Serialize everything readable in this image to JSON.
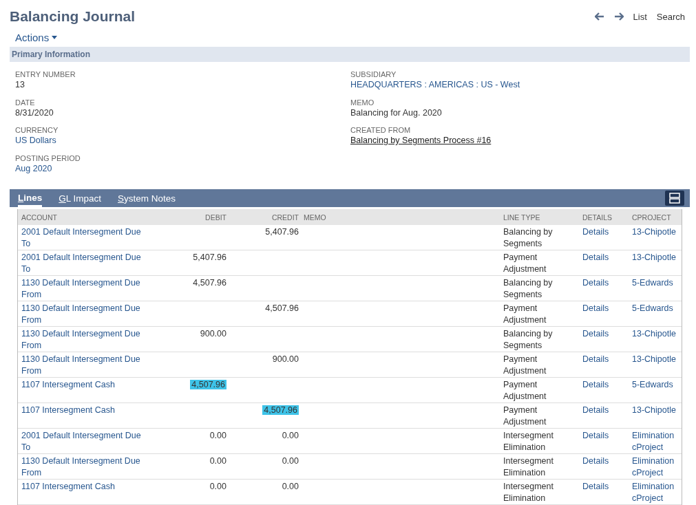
{
  "page": {
    "title": "Balancing Journal",
    "nav": [
      "List",
      "Search"
    ],
    "actions": "Actions"
  },
  "primary_information": {
    "heading": "Primary Information",
    "left": [
      {
        "label": "ENTRY NUMBER",
        "value": "13",
        "kind": "text"
      },
      {
        "label": "DATE",
        "value": "8/31/2020",
        "kind": "text"
      },
      {
        "label": "CURRENCY",
        "value": "US Dollars",
        "kind": "link"
      },
      {
        "label": "POSTING PERIOD",
        "value": "Aug 2020",
        "kind": "link"
      }
    ],
    "right": [
      {
        "label": "SUBSIDIARY",
        "value": "HEADQUARTERS : AMERICAS : US - West",
        "kind": "link"
      },
      {
        "label": "MEMO",
        "value": "Balancing for Aug. 2020",
        "kind": "text"
      },
      {
        "label": "CREATED FROM",
        "value": "Balancing by Segments Process #16",
        "kind": "record"
      }
    ]
  },
  "tabs": [
    {
      "label": "Lines",
      "selected": true
    },
    {
      "label": "GL Impact",
      "selected": false
    },
    {
      "label": "System Notes",
      "selected": false
    }
  ],
  "table": {
    "columns": [
      "ACCOUNT",
      "DEBIT",
      "CREDIT",
      "MEMO",
      "LINE TYPE",
      "DETAILS",
      "CPROJECT"
    ],
    "rows": [
      {
        "account": "2001 Default Intersegment Due To",
        "credit": {
          "text": "5,407.96",
          "highlighted": false
        },
        "line_type": "Balancing by Segments",
        "details": "Details",
        "cproject": "13-Chipotle"
      },
      {
        "account": "2001 Default Intersegment Due To",
        "debit": {
          "text": "5,407.96",
          "highlighted": false
        },
        "line_type": "Payment Adjustment",
        "details": "Details",
        "cproject": "13-Chipotle"
      },
      {
        "account": "1130 Default Intersegment Due From",
        "debit": {
          "text": "4,507.96",
          "highlighted": false
        },
        "line_type": "Balancing by Segments",
        "details": "Details",
        "cproject": "5-Edwards"
      },
      {
        "account": "1130 Default Intersegment Due From",
        "credit": {
          "text": "4,507.96",
          "highlighted": false
        },
        "line_type": "Payment Adjustment",
        "details": "Details",
        "cproject": "5-Edwards"
      },
      {
        "account": "1130 Default Intersegment Due From",
        "debit": {
          "text": "900.00",
          "highlighted": false
        },
        "line_type": "Balancing by Segments",
        "details": "Details",
        "cproject": "13-Chipotle"
      },
      {
        "account": "1130 Default Intersegment Due From",
        "credit": {
          "text": "900.00",
          "highlighted": false
        },
        "line_type": "Payment Adjustment",
        "details": "Details",
        "cproject": "13-Chipotle"
      },
      {
        "account": "1107 Intersegment Cash",
        "debit": {
          "text": "4,507.96",
          "highlighted": true
        },
        "line_type": "Payment Adjustment",
        "details": "Details",
        "cproject": "5-Edwards"
      },
      {
        "account": "1107 Intersegment Cash",
        "credit": {
          "text": "4,507.96",
          "highlighted": true
        },
        "line_type": "Payment Adjustment",
        "details": "Details",
        "cproject": "13-Chipotle"
      },
      {
        "account": "2001 Default Intersegment Due To",
        "debit": {
          "text": "0.00",
          "highlighted": false
        },
        "credit": {
          "text": "0.00",
          "highlighted": false
        },
        "line_type": "Intersegment Elimination",
        "details": "Details",
        "cproject": "Elimination cProject"
      },
      {
        "account": "1130 Default Intersegment Due From",
        "debit": {
          "text": "0.00",
          "highlighted": false
        },
        "credit": {
          "text": "0.00",
          "highlighted": false
        },
        "line_type": "Intersegment Elimination",
        "details": "Details",
        "cproject": "Elimination cProject"
      },
      {
        "account": "1107 Intersegment Cash",
        "debit": {
          "text": "0.00",
          "highlighted": false
        },
        "credit": {
          "text": "0.00",
          "highlighted": false
        },
        "line_type": "Intersegment Elimination",
        "details": "Details",
        "cproject": "Elimination cProject"
      }
    ]
  }
}
